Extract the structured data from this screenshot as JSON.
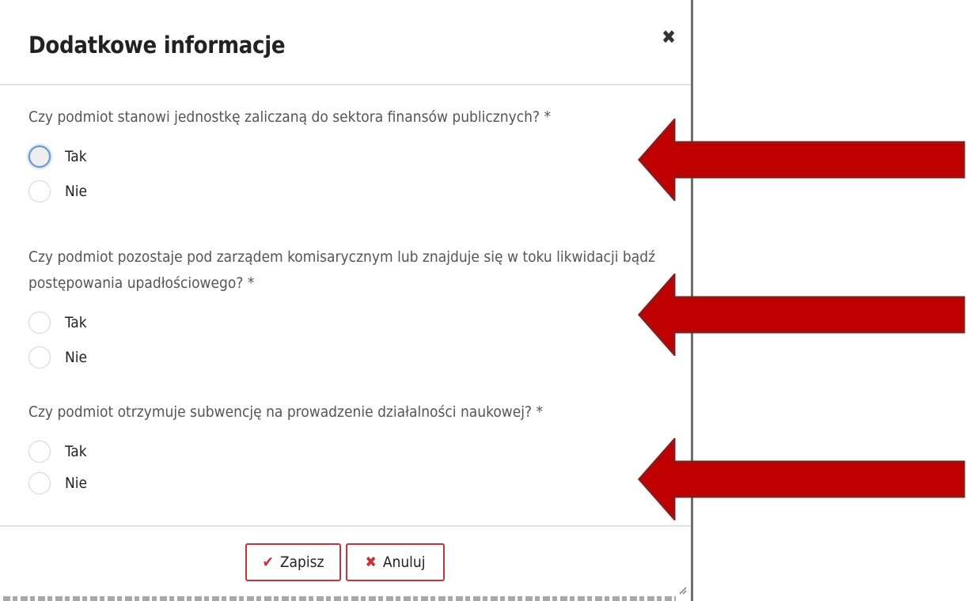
{
  "modal": {
    "title": "Dodatkowe informacje",
    "close_icon": "close-icon"
  },
  "questions": [
    {
      "text": "Czy podmiot stanowi jednostkę zaliczaną do sektora finansów publicznych? *",
      "options": [
        "Tak",
        "Nie"
      ],
      "focused_option": "Tak"
    },
    {
      "text": "Czy podmiot pozostaje pod zarządem komisarycznym lub znajduje się w toku likwidacji bądź postępowania upadłościowego? *",
      "options": [
        "Tak",
        "Nie"
      ]
    },
    {
      "text": "Czy podmiot otrzymuje subwencję na prowadzenie działalności naukowej? *",
      "options": [
        "Tak",
        "Nie"
      ]
    }
  ],
  "footer": {
    "save_label": "Zapisz",
    "save_icon": "check-icon",
    "cancel_label": "Anuluj",
    "cancel_icon": "x-icon"
  },
  "colors": {
    "accent": "#c3343d",
    "arrow": "#c00000",
    "arrow_border": "#8b1a1a",
    "focus": "#6a97cc"
  }
}
